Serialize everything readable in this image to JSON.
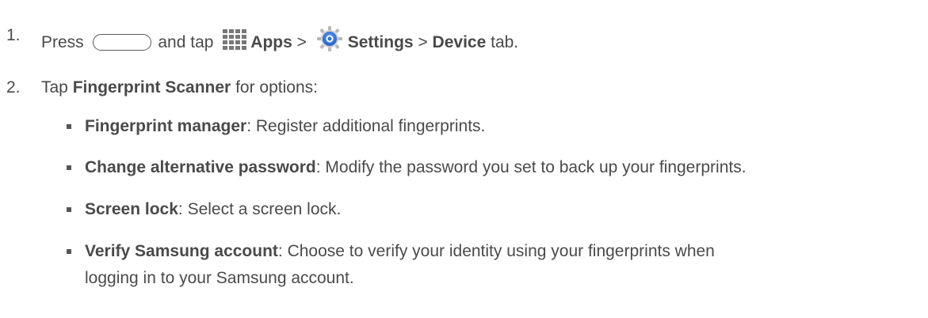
{
  "steps": [
    {
      "number": "1.",
      "parts": {
        "press": "Press",
        "and_tap": "and tap",
        "apps": "Apps",
        "sep1": ">",
        "settings": "Settings",
        "sep2": ">",
        "device": "Device",
        "tab": "tab."
      }
    },
    {
      "number": "2.",
      "parts": {
        "tap": "Tap",
        "fingerprint_scanner": "Fingerprint Scanner",
        "for_options": "for options:"
      }
    }
  ],
  "options": [
    {
      "title": "Fingerprint manager",
      "desc": ": Register additional fingerprints."
    },
    {
      "title": "Change alternative password",
      "desc": ": Modify the password you set to back up your fingerprints."
    },
    {
      "title": "Screen lock",
      "desc": ": Select a screen lock."
    },
    {
      "title": "Verify Samsung account",
      "desc": ": Choose to verify your identity using your fingerprints when",
      "desc_line2": "logging in to your Samsung account."
    }
  ],
  "icons": {
    "home": "home-button-icon",
    "apps": "apps-grid-icon",
    "settings": "settings-gear-icon"
  },
  "colors": {
    "text": "#4a4a4a",
    "settings_blue": "#2f6fd6"
  }
}
